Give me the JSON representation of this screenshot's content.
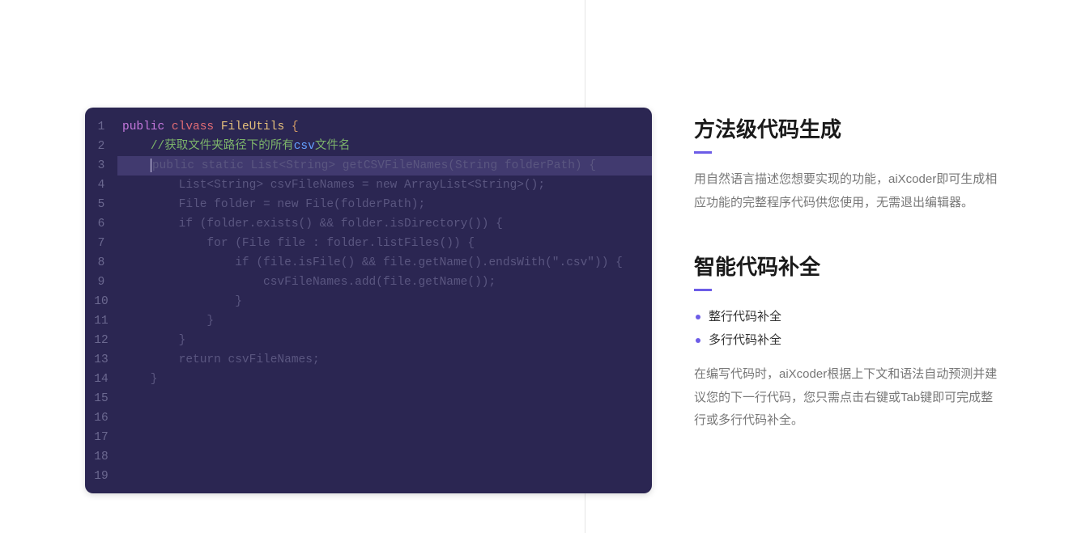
{
  "editor": {
    "line_numbers": [
      "1",
      "2",
      "3",
      "4",
      "5",
      "6",
      "7",
      "8",
      "9",
      "10",
      "11",
      "12",
      "13",
      "14",
      "15",
      "16",
      "17",
      "18",
      "19"
    ],
    "line1": {
      "kw_public": "public",
      "kw_clvass": "clvass",
      "class_name": "FileUtils",
      "brace": "{"
    },
    "line2": {
      "indent": "    ",
      "comment_prefix": "//获取文件夹路径下的所有",
      "comment_csv": "csv",
      "comment_suffix": "文件名"
    },
    "line3": {
      "indent": "    ",
      "ghost": "public static List<String> getCSVFileNames(String folderPath) {"
    },
    "line4": "        List<String> csvFileNames = new ArrayList<String>();",
    "line5": "        File folder = new File(folderPath);",
    "line6": "        if (folder.exists() && folder.isDirectory()) {",
    "line7": "            for (File file : folder.listFiles()) {",
    "line8": "                if (file.isFile() && file.getName().endsWith(\".csv\")) {",
    "line9": "                    csvFileNames.add(file.getName());",
    "line10": "                }",
    "line11": "            }",
    "line12": "        }",
    "line13": "        return csvFileNames;",
    "line14": "    }"
  },
  "features": {
    "section1": {
      "title": "方法级代码生成",
      "desc": "用自然语言描述您想要实现的功能，aiXcoder即可生成相应功能的完整程序代码供您使用，无需退出编辑器。"
    },
    "section2": {
      "title": "智能代码补全",
      "bullets": [
        "整行代码补全",
        "多行代码补全"
      ],
      "desc": "在编写代码时，aiXcoder根据上下文和语法自动预测并建议您的下一行代码，您只需点击右键或Tab键即可完成整行或多行代码补全。"
    }
  }
}
